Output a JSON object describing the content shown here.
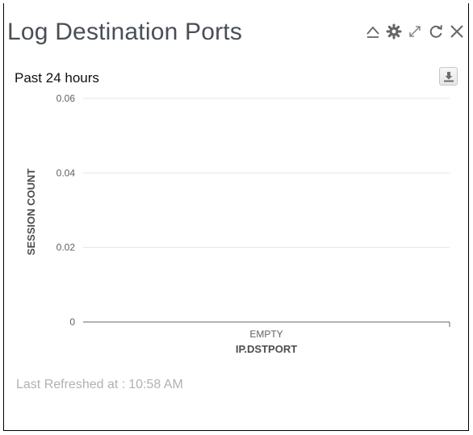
{
  "widget": {
    "title": "Log Destination Ports",
    "time_range": "Past 24 hours",
    "icons": [
      "collapse-icon",
      "gear-icon",
      "expand-icon",
      "refresh-icon",
      "close-icon"
    ],
    "last_refreshed_label": "Last Refreshed at :",
    "last_refreshed_time": "10:58 AM"
  },
  "chart_data": {
    "type": "bar",
    "categories": [
      "EMPTY"
    ],
    "values": [
      0
    ],
    "xlabel": "IP.DSTPORT",
    "ylabel": "SESSION COUNT",
    "ylim": [
      0,
      0.06
    ],
    "yticks": [
      "0",
      "0.02",
      "0.04",
      "0.06"
    ],
    "grid": true
  }
}
